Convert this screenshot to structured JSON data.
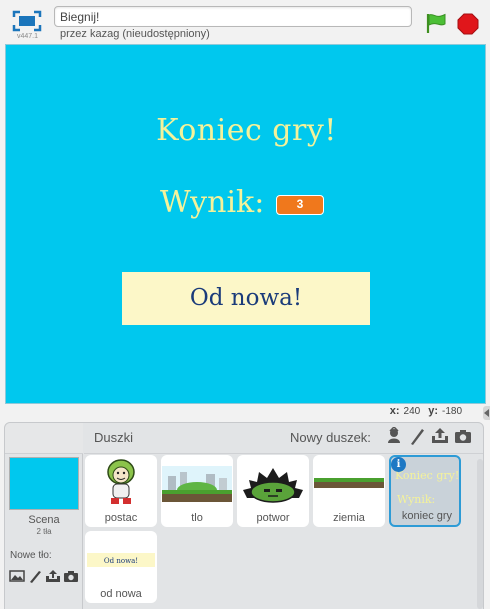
{
  "header": {
    "version": "v447.1",
    "project_title": "Biegnij!",
    "author": "przez kazag (nieudostępniony)",
    "green_flag_icon": "green-flag-icon",
    "stop_icon": "stop-sign-icon"
  },
  "stage": {
    "background_color": "#00c8ee",
    "game_over_text": "Koniec gry!",
    "score_label": "Wynik:",
    "score_value": "3",
    "restart_button_label": "Od nowa!"
  },
  "coords": {
    "x_label": "x:",
    "x_value": "240",
    "y_label": "y:",
    "y_value": "-180"
  },
  "sprite_pane": {
    "stage_label": "Scena",
    "backdrop_count": "2 tła",
    "new_backdrop_label": "Nowe tło:",
    "sprites_tab": "Duszki",
    "new_sprite_label": "Nowy duszek:",
    "sprites": [
      {
        "name": "postac"
      },
      {
        "name": "tlo"
      },
      {
        "name": "potwor"
      },
      {
        "name": "ziemia"
      },
      {
        "name": "koniec gry",
        "selected": true
      },
      {
        "name": "od nowa"
      }
    ]
  }
}
